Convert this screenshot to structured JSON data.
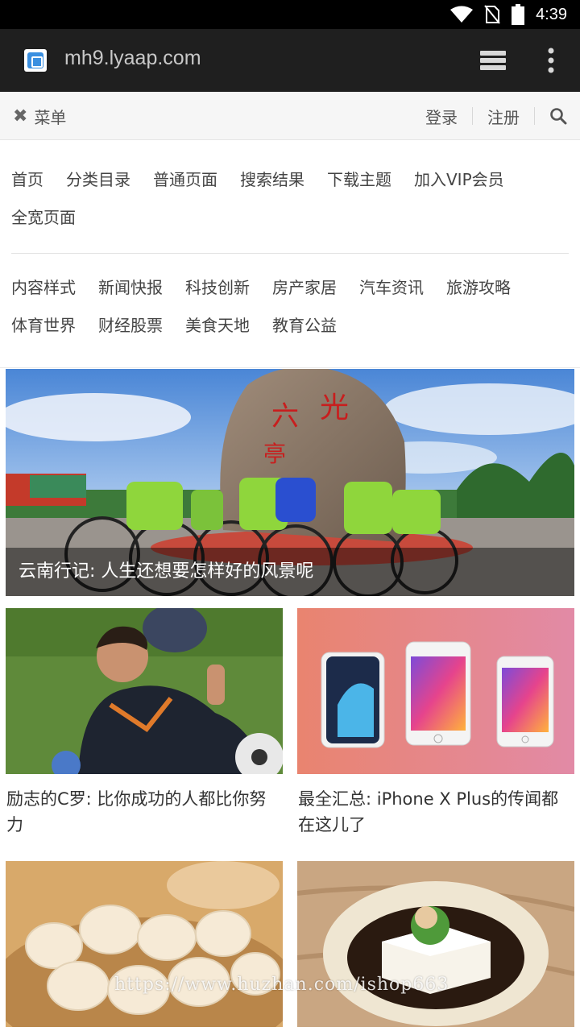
{
  "status": {
    "time": "4:39",
    "icons": [
      "wifi-icon",
      "no-sim-icon",
      "battery-icon"
    ]
  },
  "browser": {
    "url": "mh9.lyaap.com",
    "icons": [
      "site-favicon",
      "tabs-icon",
      "more-icon"
    ]
  },
  "topbar": {
    "menu_label": "菜单",
    "login_label": "登录",
    "register_label": "注册"
  },
  "nav": {
    "primary": [
      "首页",
      "分类目录",
      "普通页面",
      "搜索结果",
      "下载主题",
      "加入VIP会员",
      "全宽页面"
    ],
    "categories": [
      "内容样式",
      "新闻快报",
      "科技创新",
      "房产家居",
      "汽车资讯",
      "旅游攻略",
      "体育世界",
      "财经股票",
      "美食天地",
      "教育公益"
    ]
  },
  "hero": {
    "caption": "云南行记: 人生还想要怎样好的风景呢"
  },
  "cards": [
    {
      "title": "励志的C罗: 比你成功的人都比你努力"
    },
    {
      "title": "最全汇总: iPhone X Plus的传闻都在这儿了"
    },
    {
      "title": ""
    },
    {
      "title": ""
    }
  ],
  "watermark": "https://www.huzhan.com/ishop663",
  "colors": {
    "status_bar": "#000000",
    "browser_bar": "#1f1f1f",
    "topbar_bg": "#f6f6f6",
    "accent_blue": "#3a8fe0"
  }
}
